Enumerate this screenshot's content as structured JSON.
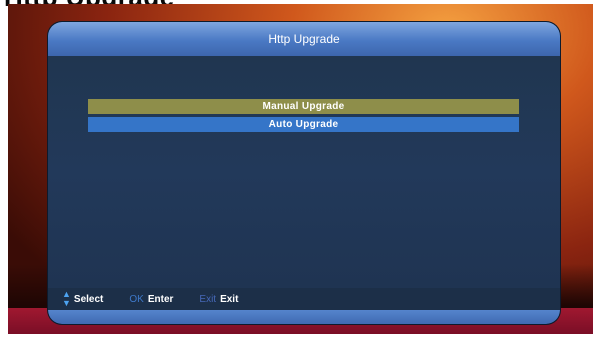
{
  "caption": "Http Upgrade",
  "window": {
    "title": "Http Upgrade"
  },
  "menu": {
    "items": [
      {
        "label": "Manual Upgrade",
        "state": "selected"
      },
      {
        "label": "Auto Upgrade",
        "state": "normal"
      }
    ]
  },
  "footer": {
    "hints": [
      {
        "icon": "up-down-arrows-icon",
        "key": "",
        "label": "Select"
      },
      {
        "icon": "",
        "key": "OK",
        "label": "Enter"
      },
      {
        "icon": "",
        "key": "Exit",
        "label": "Exit"
      }
    ]
  },
  "colors": {
    "selected_item": "#8e8e4a",
    "normal_item": "#3575c8",
    "header": "#4a79c4",
    "panel": "#223a58"
  }
}
